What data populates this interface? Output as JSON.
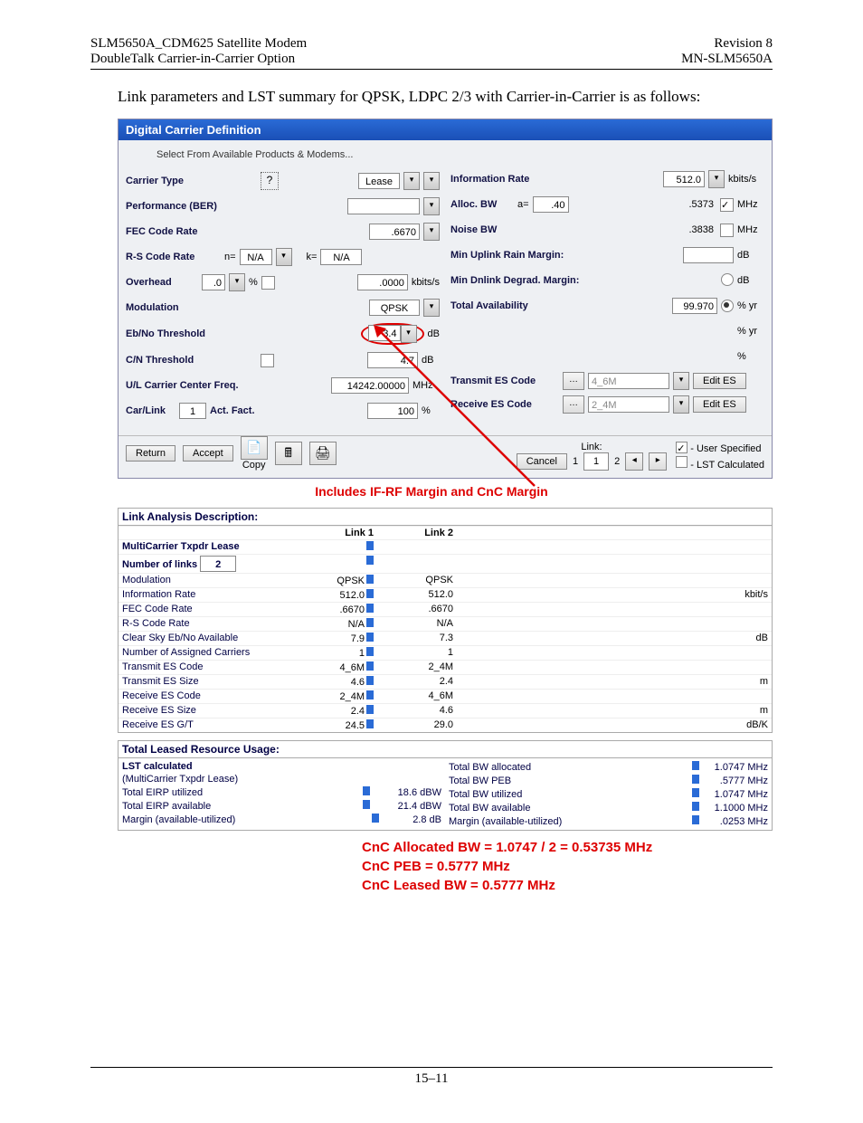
{
  "header": {
    "titleLeft1": "SLM5650A_CDM625 Satellite Modem",
    "titleLeft2": "DoubleTalk Carrier-in-Carrier Option",
    "titleRight1": "Revision 8",
    "titleRight2": "MN-SLM5650A"
  },
  "intro": "Link parameters and LST summary for QPSK, LDPC 2/3 with Carrier-in-Carrier is as follows:",
  "panel": {
    "title": "Digital Carrier Definition",
    "selectLine": "Select From Available Products & Modems...",
    "left": {
      "carrierType": {
        "label": "Carrier Type",
        "value": "Lease"
      },
      "perf": {
        "label": "Performance (BER)",
        "value": ""
      },
      "fec": {
        "label": "FEC Code Rate",
        "value": ".6670"
      },
      "rs": {
        "label": "R-S Code Rate",
        "n": "n=",
        "nv": "N/A",
        "k": "k=",
        "kv": "N/A"
      },
      "overhead": {
        "label": "Overhead",
        "a": ".0",
        "b": ".0000",
        "unit": "kbits/s",
        "pct": "%"
      },
      "mod": {
        "label": "Modulation",
        "value": "QPSK"
      },
      "ebno": {
        "label": "Eb/No Threshold",
        "value": "3.4",
        "unit": "dB"
      },
      "cn": {
        "label": "C/N Threshold",
        "value": "4.7",
        "unit": "dB"
      },
      "ul": {
        "label": "U/L Carrier Center Freq.",
        "value": "14242.00000",
        "unit": "MHz"
      },
      "carLink": {
        "label": "Car/Link",
        "v": "1",
        "act": "Act. Fact.",
        "av": "100",
        "unit": "%"
      }
    },
    "right": {
      "info": {
        "label": "Information Rate",
        "value": "512.0",
        "unit": "kbits/s"
      },
      "alloc": {
        "label": "Alloc. BW",
        "a": "a=",
        "av": ".40",
        "value": ".5373",
        "unit": "MHz"
      },
      "noise": {
        "label": "Noise BW",
        "value": ".3838",
        "unit": "MHz"
      },
      "minUp": {
        "label": "Min Uplink Rain Margin:",
        "value": "",
        "unit": "dB"
      },
      "minDn": {
        "label": "Min Dnlink Degrad. Margin:",
        "value": "",
        "unit": "dB"
      },
      "total": {
        "label": "Total Availability",
        "value": "99.970",
        "unit": "% yr"
      },
      "blank": {
        "unit": "% yr"
      },
      "blank2": {
        "unit": "%"
      },
      "tx": {
        "label": "Transmit ES Code",
        "value": "4_6M",
        "btn": "Edit ES"
      },
      "rx": {
        "label": "Receive ES Code",
        "value": "2_4M",
        "btn": "Edit ES"
      }
    },
    "bottom": {
      "return": "Return",
      "accept": "Accept",
      "copy": "Copy",
      "cancel": "Cancel",
      "link": "Link:",
      "one": "1",
      "boxOne": "1",
      "two": "2",
      "leg1": "- User Specified",
      "leg2": "- LST Calculated"
    }
  },
  "redNote": "Includes IF-RF Margin and CnC Margin",
  "linkAnalysis": {
    "title": "Link Analysis Description:",
    "h1": "Link 1",
    "h2": "Link 2",
    "rows": [
      {
        "label": "MultiCarrier Txpdr Lease",
        "bold": true,
        "v1": "",
        "v2": "",
        "u": ""
      },
      {
        "label": "Number of links",
        "bold": true,
        "input": "2",
        "v1": "",
        "v2": "",
        "u": ""
      },
      {
        "label": "Modulation",
        "v1": "QPSK",
        "v2": "QPSK",
        "u": ""
      },
      {
        "label": "Information Rate",
        "v1": "512.0",
        "v2": "512.0",
        "u": "kbit/s"
      },
      {
        "label": "FEC Code Rate",
        "v1": ".6670",
        "v2": ".6670",
        "u": ""
      },
      {
        "label": "R-S Code Rate",
        "v1": "N/A",
        "v2": "N/A",
        "u": ""
      },
      {
        "label": "Clear Sky Eb/No Available",
        "v1": "7.9",
        "v2": "7.3",
        "u": "dB"
      },
      {
        "label": "Number of Assigned Carriers",
        "v1": "1",
        "v2": "1",
        "u": ""
      },
      {
        "label": "Transmit ES Code",
        "v1": "4_6M",
        "v2": "2_4M",
        "u": ""
      },
      {
        "label": "Transmit ES Size",
        "v1": "4.6",
        "v2": "2.4",
        "u": "m"
      },
      {
        "label": "Receive ES Code",
        "v1": "2_4M",
        "v2": "4_6M",
        "u": ""
      },
      {
        "label": "Receive ES Size",
        "v1": "2.4",
        "v2": "4.6",
        "u": "m"
      },
      {
        "label": "Receive ES G/T",
        "v1": "24.5",
        "v2": "29.0",
        "u": "dB/K"
      }
    ]
  },
  "totals": {
    "title": "Total Leased Resource Usage:",
    "left": [
      {
        "label": "LST calculated",
        "b": true,
        "v": "",
        "u": ""
      },
      {
        "label": "(MultiCarrier Txpdr Lease)",
        "v": "",
        "u": ""
      },
      {
        "label": "Total EIRP utilized",
        "v": "18.6",
        "u": "dBW"
      },
      {
        "label": "Total EIRP available",
        "v": "21.4",
        "u": "dBW"
      },
      {
        "label": "Margin (available-utilized)",
        "v": "2.8",
        "u": "dB"
      }
    ],
    "right": [
      {
        "label": "Total BW allocated",
        "v": "1.0747",
        "u": "MHz"
      },
      {
        "label": "Total BW PEB",
        "v": ".5777",
        "u": "MHz"
      },
      {
        "label": "Total BW utilized",
        "v": "1.0747",
        "u": "MHz"
      },
      {
        "label": "Total BW available",
        "v": "1.1000",
        "u": "MHz"
      },
      {
        "label": "Margin (available-utilized)",
        "v": ".0253",
        "u": "MHz"
      }
    ]
  },
  "cnc": {
    "l1": "CnC Allocated BW = 1.0747 / 2 = 0.53735 MHz",
    "l2": "CnC PEB = 0.5777 MHz",
    "l3": "CnC Leased BW = 0.5777 MHz"
  },
  "footer": {
    "page": "15–11"
  },
  "chart_data": {
    "type": "table",
    "title": "Link Analysis Description",
    "series": [
      {
        "name": "Link 1",
        "values": {
          "Modulation": "QPSK",
          "Information Rate kbit/s": 512.0,
          "FEC Code Rate": 0.667,
          "R-S Code Rate": "N/A",
          "Clear Sky Eb/No Available dB": 7.9,
          "Number of Assigned Carriers": 1,
          "Transmit ES Code": "4_6M",
          "Transmit ES Size m": 4.6,
          "Receive ES Code": "2_4M",
          "Receive ES Size m": 2.4,
          "Receive ES G/T dB/K": 24.5
        }
      },
      {
        "name": "Link 2",
        "values": {
          "Modulation": "QPSK",
          "Information Rate kbit/s": 512.0,
          "FEC Code Rate": 0.667,
          "R-S Code Rate": "N/A",
          "Clear Sky Eb/No Available dB": 7.3,
          "Number of Assigned Carriers": 1,
          "Transmit ES Code": "2_4M",
          "Transmit ES Size m": 2.4,
          "Receive ES Code": "4_6M",
          "Receive ES Size m": 4.6,
          "Receive ES G/T dB/K": 29.0
        }
      }
    ],
    "totals": {
      "Total EIRP utilized dBW": 18.6,
      "Total EIRP available dBW": 21.4,
      "EIRP Margin dB": 2.8,
      "Total BW allocated MHz": 1.0747,
      "Total BW PEB MHz": 0.5777,
      "Total BW utilized MHz": 1.0747,
      "Total BW available MHz": 1.1,
      "BW Margin MHz": 0.0253
    }
  }
}
